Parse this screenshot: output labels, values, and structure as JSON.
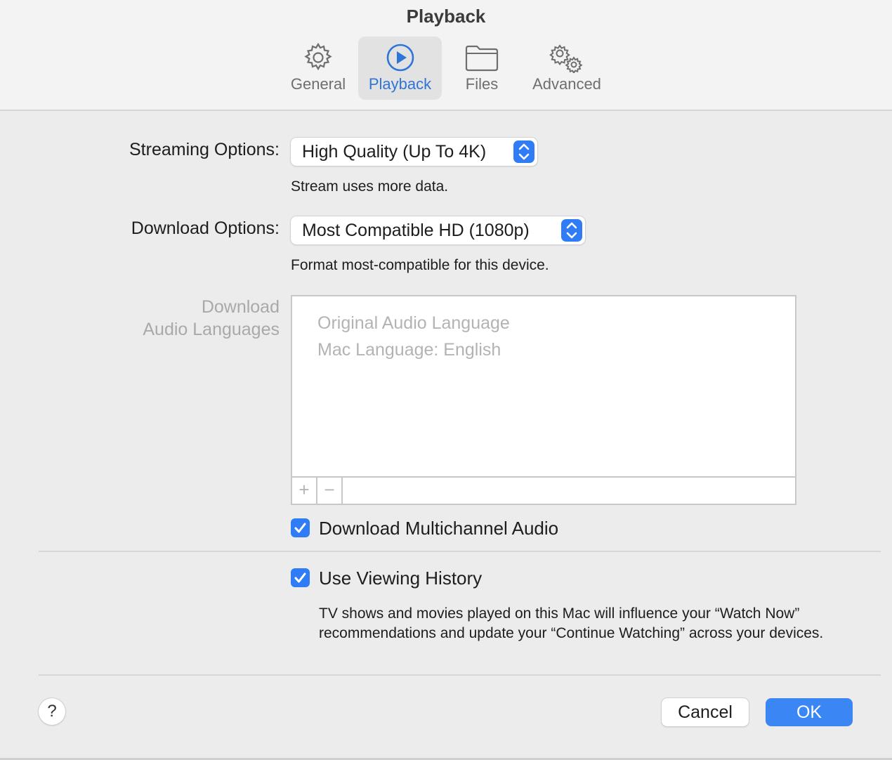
{
  "window": {
    "title": "Playback"
  },
  "tabs": [
    {
      "label": "General",
      "icon": "gear-icon",
      "active": false
    },
    {
      "label": "Playback",
      "icon": "play-circle-icon",
      "active": true
    },
    {
      "label": "Files",
      "icon": "folder-icon",
      "active": false
    },
    {
      "label": "Advanced",
      "icon": "gears-icon",
      "active": false
    }
  ],
  "streaming": {
    "label": "Streaming Options:",
    "value": "High Quality (Up To 4K)",
    "hint": "Stream uses more data."
  },
  "download": {
    "label": "Download Options:",
    "value": "Most Compatible HD (1080p)",
    "hint": "Format most-compatible for this device."
  },
  "audio_languages": {
    "label_line1": "Download",
    "label_line2": "Audio Languages",
    "items": [
      "Original Audio Language",
      "Mac Language: English"
    ],
    "add_label": "+",
    "remove_label": "−"
  },
  "multichannel": {
    "label": "Download Multichannel Audio",
    "checked": true
  },
  "viewing_history": {
    "label": "Use Viewing History",
    "checked": true,
    "description": "TV shows and movies played on this Mac will influence your “Watch Now” recommendations and update your “Continue Watching” across your devices."
  },
  "footer": {
    "help_label": "?",
    "cancel_label": "Cancel",
    "ok_label": "OK"
  },
  "colors": {
    "accent": "#2f7cf6",
    "active_tab_text": "#2f74d8",
    "background": "#ececec"
  }
}
